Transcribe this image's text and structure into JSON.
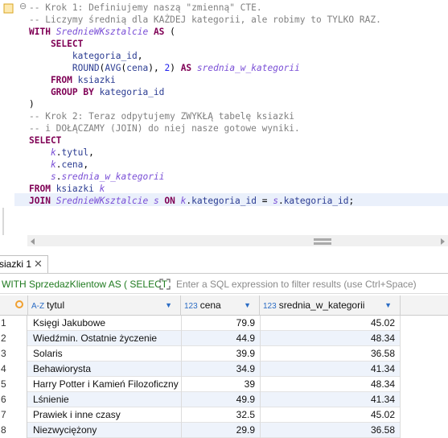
{
  "editor": {
    "lines": [
      [
        {
          "t": "-- Krok 1: Definiujemy naszą \"zmienną\" CTE.",
          "c": "cmt"
        }
      ],
      [
        {
          "t": "-- Liczymy średnią dla KAŻDEJ kategorii, ale robimy to TYLKO RAZ.",
          "c": "cmt"
        }
      ],
      [
        {
          "t": "WITH ",
          "c": "kw"
        },
        {
          "t": "SrednieWKsztalcie",
          "c": "cte"
        },
        {
          "t": " AS ",
          "c": "kw"
        },
        {
          "t": "(",
          "c": "plain"
        }
      ],
      [
        {
          "t": "    SELECT",
          "c": "kw"
        }
      ],
      [
        {
          "t": "        kategoria_id",
          "c": "id"
        },
        {
          "t": ",",
          "c": "plain"
        }
      ],
      [
        {
          "t": "        ROUND",
          "c": "id"
        },
        {
          "t": "(",
          "c": "plain"
        },
        {
          "t": "AVG",
          "c": "id"
        },
        {
          "t": "(",
          "c": "plain"
        },
        {
          "t": "cena",
          "c": "id"
        },
        {
          "t": "), ",
          "c": "plain"
        },
        {
          "t": "2",
          "c": "num"
        },
        {
          "t": ") ",
          "c": "plain"
        },
        {
          "t": "AS ",
          "c": "kw"
        },
        {
          "t": "srednia_w_kategorii",
          "c": "alias"
        }
      ],
      [
        {
          "t": "    FROM ",
          "c": "kw"
        },
        {
          "t": "ksiazki",
          "c": "id"
        }
      ],
      [
        {
          "t": "    GROUP BY ",
          "c": "kw"
        },
        {
          "t": "kategoria_id",
          "c": "id"
        }
      ],
      [
        {
          "t": ")",
          "c": "plain"
        }
      ],
      [
        {
          "t": "-- Krok 2: Teraz odpytujemy ZWYKŁĄ tabelę ksiazki",
          "c": "cmt"
        }
      ],
      [
        {
          "t": "-- i DOŁĄCZAMY (JOIN) do niej nasze gotowe wyniki.",
          "c": "cmt"
        }
      ],
      [
        {
          "t": "SELECT",
          "c": "kw"
        }
      ],
      [
        {
          "t": "    ",
          "c": "plain"
        },
        {
          "t": "k",
          "c": "alias"
        },
        {
          "t": ".",
          "c": "plain"
        },
        {
          "t": "tytul",
          "c": "id"
        },
        {
          "t": ",",
          "c": "plain"
        }
      ],
      [
        {
          "t": "    ",
          "c": "plain"
        },
        {
          "t": "k",
          "c": "alias"
        },
        {
          "t": ".",
          "c": "plain"
        },
        {
          "t": "cena",
          "c": "id"
        },
        {
          "t": ",",
          "c": "plain"
        }
      ],
      [
        {
          "t": "    ",
          "c": "plain"
        },
        {
          "t": "s",
          "c": "alias"
        },
        {
          "t": ".",
          "c": "plain"
        },
        {
          "t": "srednia_w_kategorii",
          "c": "alias"
        }
      ],
      [
        {
          "t": "FROM ",
          "c": "kw"
        },
        {
          "t": "ksiazki ",
          "c": "id"
        },
        {
          "t": "k",
          "c": "alias"
        }
      ],
      [
        {
          "t": "JOIN ",
          "c": "kw"
        },
        {
          "t": "SrednieWKsztalcie ",
          "c": "cte"
        },
        {
          "t": "s",
          "c": "alias"
        },
        {
          "t": " ON ",
          "c": "kw"
        },
        {
          "t": "k",
          "c": "alias"
        },
        {
          "t": ".",
          "c": "plain"
        },
        {
          "t": "kategoria_id",
          "c": "id"
        },
        {
          "t": " = ",
          "c": "plain"
        },
        {
          "t": "s",
          "c": "alias"
        },
        {
          "t": ".",
          "c": "plain"
        },
        {
          "t": "kategoria_id",
          "c": "id"
        },
        {
          "t": ";",
          "c": "plain"
        }
      ]
    ]
  },
  "results": {
    "tab_label": "siazki 1",
    "close_glyph": "✕",
    "query_text": "WITH SprzedazKlientow AS ( SELECT",
    "filter_placeholder": "Enter a SQL expression to filter results (use Ctrl+Space)",
    "columns": [
      {
        "type": "A-Z",
        "name": "tytul"
      },
      {
        "type": "123",
        "name": "cena"
      },
      {
        "type": "123",
        "name": "srednia_w_kategorii"
      }
    ],
    "rows": [
      {
        "n": "1",
        "tytul": "Księgi Jakubowe",
        "cena": "79.9",
        "srednia": "45.02"
      },
      {
        "n": "2",
        "tytul": "Wiedźmin. Ostatnie życzenie",
        "cena": "44.9",
        "srednia": "48.34"
      },
      {
        "n": "3",
        "tytul": "Solaris",
        "cena": "39.9",
        "srednia": "36.58"
      },
      {
        "n": "4",
        "tytul": "Behawiorysta",
        "cena": "34.9",
        "srednia": "41.34"
      },
      {
        "n": "5",
        "tytul": "Harry Potter i Kamień Filozoficzny",
        "cena": "39",
        "srednia": "48.34"
      },
      {
        "n": "6",
        "tytul": "Lśnienie",
        "cena": "49.9",
        "srednia": "41.34"
      },
      {
        "n": "7",
        "tytul": "Prawiek i inne czasy",
        "cena": "32.5",
        "srednia": "45.02"
      },
      {
        "n": "8",
        "tytul": "Niezwyciężony",
        "cena": "29.9",
        "srednia": "36.58"
      }
    ]
  },
  "colors": {
    "keyword": "#7f0055",
    "comment": "#808080",
    "identifier": "#2b3c92",
    "cte": "#7a4fd6",
    "accent": "#2b6cc4"
  }
}
